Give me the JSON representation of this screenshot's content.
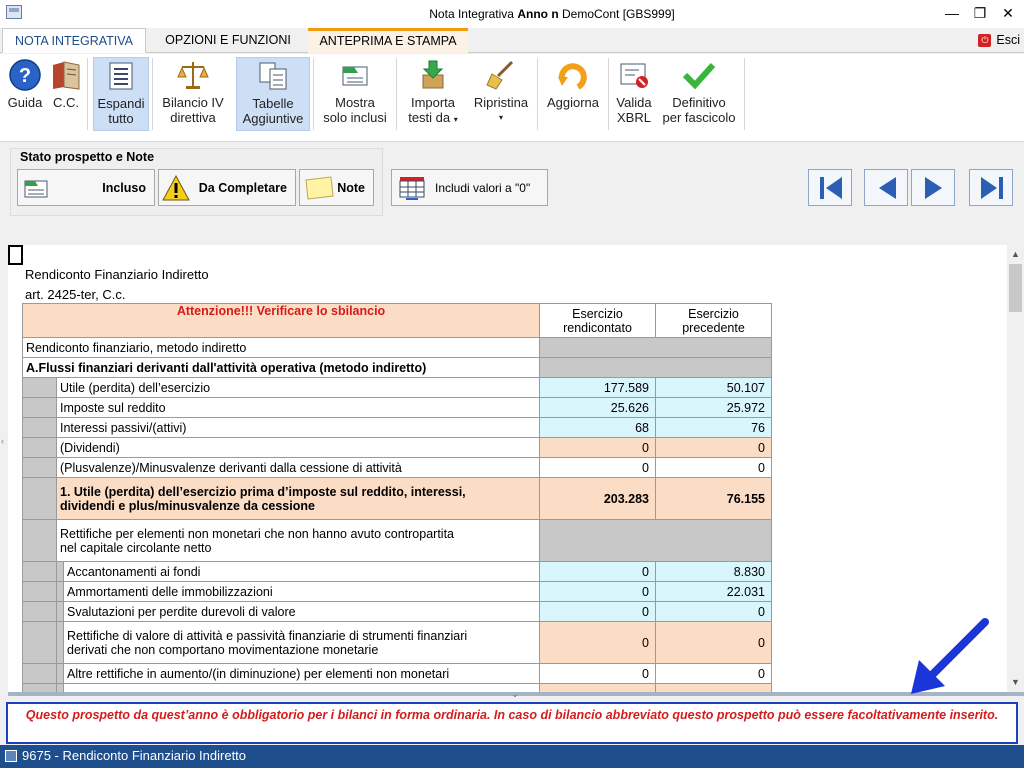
{
  "window": {
    "title_prefix": "Nota Integrativa",
    "title_bold": "Anno n",
    "title_suffix": "DemoCont [GBS999]",
    "minimize_glyph": "—",
    "restore_glyph": "❐",
    "close_glyph": "✕"
  },
  "tabs": {
    "nota": "NOTA INTEGRATIVA",
    "opzioni": "OPZIONI E FUNZIONI",
    "anteprima": "ANTEPRIMA E STAMPA",
    "esci": "Esci"
  },
  "ribbon": {
    "guida": "Guida",
    "cc": "C.C.",
    "espandi_1": "Espandi",
    "espandi_2": "tutto",
    "bilancio_1": "Bilancio IV",
    "bilancio_2": "direttiva",
    "tabelle_1": "Tabelle",
    "tabelle_2": "Aggiuntive",
    "mostra_1": "Mostra",
    "mostra_2": "solo inclusi",
    "importa_1": "Importa",
    "importa_2": "testi da",
    "ripristina_1": "Ripristina",
    "aggiorna": "Aggiorna",
    "valida_1": "Valida",
    "valida_2": "XBRL",
    "definitivo_1": "Definitivo",
    "definitivo_2": "per fascicolo"
  },
  "stato": {
    "title": "Stato prospetto e Note",
    "incluso": "Incluso",
    "da_completare": "Da Completare",
    "note": "Note",
    "includi_zero": "Includi valori a \"0\""
  },
  "document": {
    "heading": "Rendiconto Finanziario Indiretto",
    "article": "art. 2425-ter, C.c.",
    "warning": "Attenzione!!! Verificare lo sbilancio",
    "col_current_1": "Esercizio",
    "col_current_2": "rendicontato",
    "col_prev_1": "Esercizio",
    "col_prev_2": "precedente",
    "row_method": "Rendiconto finanziario, metodo indiretto",
    "section_a": "A.Flussi finanziari derivanti dall'attività operativa (metodo indiretto)",
    "rows_a": [
      {
        "label": "Utile (perdita) dell’esercizio",
        "cur": "177.589",
        "prev": "50.107"
      },
      {
        "label": "Imposte sul reddito",
        "cur": "25.626",
        "prev": "25.972"
      },
      {
        "label": "Interessi passivi/(attivi)",
        "cur": "68",
        "prev": "76"
      },
      {
        "label": "(Dividendi)",
        "cur": "0",
        "prev": "0"
      },
      {
        "label": "(Plusvalenze)/Minusvalenze derivanti dalla cessione di attività",
        "cur": "0",
        "prev": "0"
      }
    ],
    "total_1_line1": "1. Utile (perdita) dell’esercizio prima d’imposte sul reddito, interessi,",
    "total_1_line2": "dividendi e plus/minusvalenze da cessione",
    "total_1_cur": "203.283",
    "total_1_prev": "76.155",
    "rettifiche_line1": "Rettifiche per elementi non monetari che non hanno avuto contropartita",
    "rettifiche_line2": "nel capitale circolante netto",
    "rows_b": [
      {
        "label": "Accantonamenti ai fondi",
        "cur": "0",
        "prev": "8.830"
      },
      {
        "label": "Ammortamenti delle immobilizzazioni",
        "cur": "0",
        "prev": "22.031"
      },
      {
        "label": "Svalutazioni per perdite durevoli di valore",
        "cur": "0",
        "prev": "0"
      }
    ],
    "rett_fin_line1": "Rettifiche di valore di attività e passività finanziarie di strumenti finanziari",
    "rett_fin_line2": "derivati che non comportano movimentazione monetarie",
    "rett_fin_cur": "0",
    "rett_fin_prev": "0",
    "altre_label": "Altre rettifiche in aumento/(in diminuzione) per elementi non monetari",
    "altre_cur": "0",
    "altre_prev": "0"
  },
  "note_text": "Questo prospetto da quest’anno è obbligatorio per i bilanci in forma ordinaria. In caso di bilancio abbreviato questo prospetto può essere facoltativamente inserito.",
  "status": {
    "text": "9675 - Rendiconto Finanziario Indiretto"
  },
  "colors": {
    "accent_blue": "#1f4e8c",
    "warning_red": "#d41c1c",
    "cell_blue": "#d9f6fd",
    "cell_orange": "#fbdcc5"
  }
}
